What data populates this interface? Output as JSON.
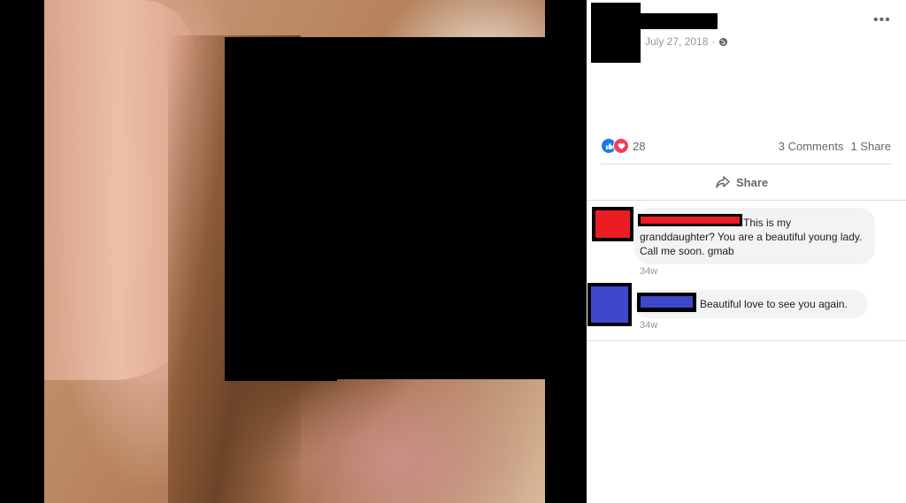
{
  "post": {
    "date": "July 27, 2018",
    "separator": "·",
    "more_label": "•••",
    "reaction_count": "28",
    "comments_count": "3 Comments",
    "shares_count": "1 Share",
    "share_label": "Share"
  },
  "comments": [
    {
      "text": "This is my granddaughter? You are a beautiful young lady. Call me soon. gmab",
      "time": "34w",
      "avatar_color": "#ec1c24"
    },
    {
      "text": "Beautiful love to see you again.",
      "time": "34w",
      "avatar_color": "#3f48cc"
    }
  ],
  "colors": {
    "like": "#1877f2",
    "love": "#f33e58",
    "meta_text": "#90949c",
    "secondary_text": "#606770"
  }
}
